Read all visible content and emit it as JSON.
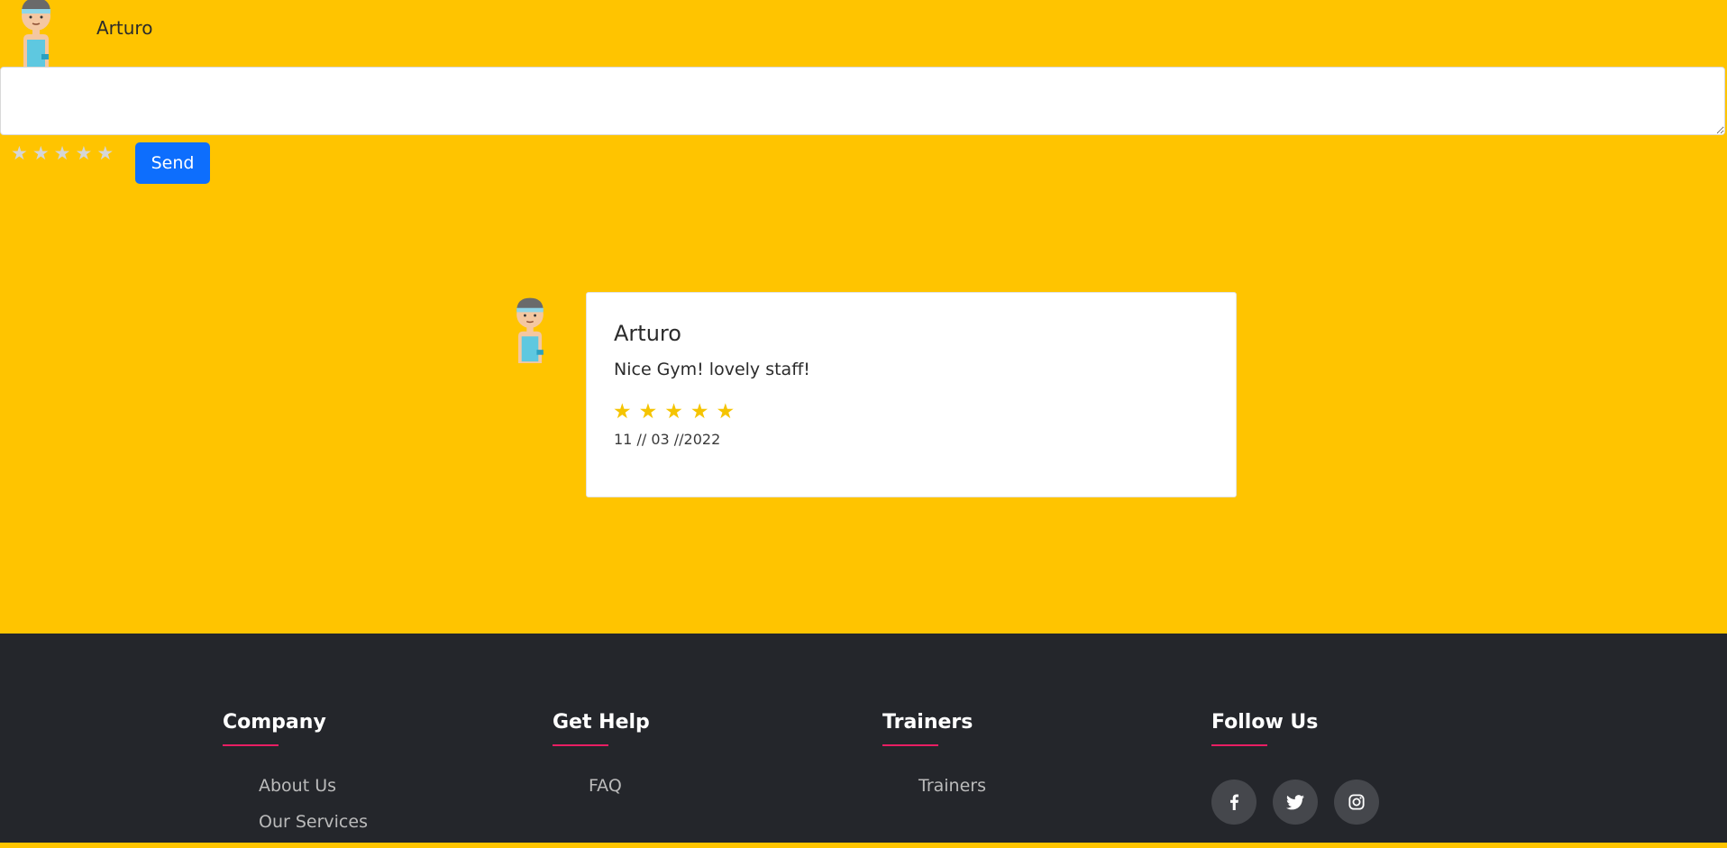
{
  "composer": {
    "user_name": "Arturo",
    "comment_value": "",
    "stars": [
      "★",
      "★",
      "★",
      "★",
      "★"
    ],
    "send_label": "Send"
  },
  "review": {
    "author": "Arturo",
    "text": "Nice Gym! lovely staff!",
    "rating": 5,
    "stars": [
      "★",
      "★",
      "★",
      "★",
      "★"
    ],
    "date": "11 // 03 //2022"
  },
  "footer": {
    "company": {
      "title": "Company",
      "links": [
        "About Us",
        "Our Services"
      ]
    },
    "help": {
      "title": "Get Help",
      "links": [
        "FAQ"
      ]
    },
    "trainers": {
      "title": "Trainers",
      "links": [
        "Trainers"
      ]
    },
    "follow": {
      "title": "Follow Us",
      "icons": [
        "facebook-icon",
        "twitter-icon",
        "instagram-icon"
      ]
    }
  },
  "colors": {
    "background": "#ffc400",
    "footer": "#24262b",
    "accent": "#e91e63",
    "button": "#0d6efd",
    "star_filled": "#f5c400",
    "star_empty": "#d6d6d6"
  }
}
